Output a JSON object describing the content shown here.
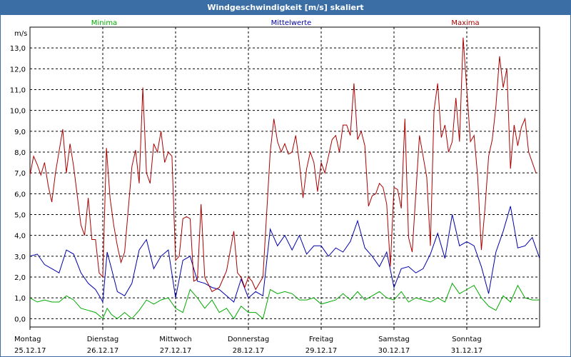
{
  "window": {
    "title": "Windgeschwindigkeit [m/s] skaliert"
  },
  "colors": {
    "titlebar": "#3a6ea5",
    "minima": "#00aa00",
    "mittel": "#0000aa",
    "maxima": "#aa0000",
    "grid": "#000000"
  },
  "chart_data": {
    "type": "line",
    "title": "Windgeschwindigkeit [m/s] skaliert",
    "ylabel": "m/s",
    "xlabel": "",
    "ylim": [
      -0.4,
      14.0
    ],
    "yticks": [
      "0,0",
      "1,0",
      "2,0",
      "3,0",
      "4,0",
      "5,0",
      "6,0",
      "7,0",
      "8,0",
      "9,0",
      "10,0",
      "11,0",
      "12,0",
      "13,0"
    ],
    "ytick_values": [
      0,
      1,
      2,
      3,
      4,
      5,
      6,
      7,
      8,
      9,
      10,
      11,
      12,
      13
    ],
    "xlim": [
      0,
      7
    ],
    "day_labels": [
      {
        "day": "Montag",
        "date": "25.12.17"
      },
      {
        "day": "Dienstag",
        "date": "26.12.17"
      },
      {
        "day": "Mittwoch",
        "date": "27.12.17"
      },
      {
        "day": "Donnerstag",
        "date": "28.12.17"
      },
      {
        "day": "Freitag",
        "date": "29.12.17"
      },
      {
        "day": "Samstag",
        "date": "30.12.17"
      },
      {
        "day": "Sonntag",
        "date": "31.12.17"
      }
    ],
    "grid": true,
    "legend_position": "top",
    "series": [
      {
        "name": "Minima",
        "color": "#00aa00",
        "points": [
          [
            0,
            1.0
          ],
          [
            0.1,
            0.8
          ],
          [
            0.2,
            0.9
          ],
          [
            0.3,
            0.8
          ],
          [
            0.4,
            0.8
          ],
          [
            0.5,
            1.1
          ],
          [
            0.6,
            0.9
          ],
          [
            0.7,
            0.5
          ],
          [
            0.8,
            0.4
          ],
          [
            0.9,
            0.3
          ],
          [
            1.0,
            0.0
          ],
          [
            1.06,
            0.5
          ],
          [
            1.12,
            0.2
          ],
          [
            1.2,
            0.0
          ],
          [
            1.3,
            0.3
          ],
          [
            1.4,
            0.0
          ],
          [
            1.5,
            0.4
          ],
          [
            1.6,
            0.9
          ],
          [
            1.7,
            0.7
          ],
          [
            1.8,
            0.9
          ],
          [
            1.9,
            1.0
          ],
          [
            2.0,
            0.5
          ],
          [
            2.1,
            0.3
          ],
          [
            2.2,
            1.4
          ],
          [
            2.3,
            1.0
          ],
          [
            2.4,
            0.5
          ],
          [
            2.5,
            0.9
          ],
          [
            2.6,
            0.3
          ],
          [
            2.7,
            0.5
          ],
          [
            2.8,
            0.0
          ],
          [
            2.9,
            0.6
          ],
          [
            3.0,
            0.3
          ],
          [
            3.1,
            0.3
          ],
          [
            3.2,
            0.0
          ],
          [
            3.3,
            1.4
          ],
          [
            3.4,
            1.2
          ],
          [
            3.5,
            1.3
          ],
          [
            3.6,
            1.2
          ],
          [
            3.7,
            0.9
          ],
          [
            3.8,
            0.9
          ],
          [
            3.9,
            1.0
          ],
          [
            4.0,
            0.7
          ],
          [
            4.1,
            0.8
          ],
          [
            4.2,
            0.9
          ],
          [
            4.3,
            1.2
          ],
          [
            4.4,
            0.9
          ],
          [
            4.5,
            1.3
          ],
          [
            4.6,
            0.9
          ],
          [
            4.7,
            1.1
          ],
          [
            4.8,
            1.3
          ],
          [
            4.9,
            1.0
          ],
          [
            5.0,
            0.9
          ],
          [
            5.1,
            1.3
          ],
          [
            5.2,
            0.8
          ],
          [
            5.3,
            1.0
          ],
          [
            5.4,
            0.9
          ],
          [
            5.5,
            0.8
          ],
          [
            5.6,
            1.0
          ],
          [
            5.7,
            0.8
          ],
          [
            5.8,
            1.7
          ],
          [
            5.9,
            1.2
          ],
          [
            6.0,
            1.4
          ],
          [
            6.1,
            1.6
          ],
          [
            6.2,
            1.0
          ],
          [
            6.3,
            0.6
          ],
          [
            6.4,
            0.4
          ],
          [
            6.5,
            1.1
          ],
          [
            6.6,
            0.8
          ],
          [
            6.7,
            1.6
          ],
          [
            6.8,
            1.0
          ],
          [
            6.9,
            0.9
          ],
          [
            7.0,
            0.9
          ]
        ]
      },
      {
        "name": "Mittelwerte",
        "color": "#0000aa",
        "points": [
          [
            0,
            3.0
          ],
          [
            0.1,
            3.1
          ],
          [
            0.2,
            2.6
          ],
          [
            0.3,
            2.4
          ],
          [
            0.4,
            2.2
          ],
          [
            0.5,
            3.3
          ],
          [
            0.6,
            3.1
          ],
          [
            0.7,
            2.2
          ],
          [
            0.8,
            1.7
          ],
          [
            0.9,
            1.4
          ],
          [
            0.97,
            1.0
          ],
          [
            1.0,
            0.8
          ],
          [
            1.06,
            3.2
          ],
          [
            1.12,
            2.4
          ],
          [
            1.2,
            1.3
          ],
          [
            1.3,
            1.1
          ],
          [
            1.4,
            1.7
          ],
          [
            1.5,
            3.3
          ],
          [
            1.6,
            3.8
          ],
          [
            1.7,
            2.4
          ],
          [
            1.8,
            3.0
          ],
          [
            1.9,
            3.3
          ],
          [
            2.0,
            1.0
          ],
          [
            2.1,
            2.8
          ],
          [
            2.2,
            3.0
          ],
          [
            2.3,
            1.8
          ],
          [
            2.4,
            1.7
          ],
          [
            2.5,
            1.5
          ],
          [
            2.6,
            1.4
          ],
          [
            2.7,
            1.1
          ],
          [
            2.8,
            0.8
          ],
          [
            2.9,
            1.9
          ],
          [
            3.0,
            1.0
          ],
          [
            3.1,
            1.3
          ],
          [
            3.2,
            1.1
          ],
          [
            3.3,
            4.3
          ],
          [
            3.4,
            3.5
          ],
          [
            3.5,
            4.0
          ],
          [
            3.6,
            3.3
          ],
          [
            3.7,
            4.0
          ],
          [
            3.8,
            3.1
          ],
          [
            3.9,
            3.5
          ],
          [
            4.0,
            3.5
          ],
          [
            4.1,
            3.0
          ],
          [
            4.2,
            3.4
          ],
          [
            4.3,
            3.2
          ],
          [
            4.4,
            3.7
          ],
          [
            4.5,
            4.7
          ],
          [
            4.6,
            3.4
          ],
          [
            4.7,
            3.0
          ],
          [
            4.8,
            2.5
          ],
          [
            4.9,
            3.2
          ],
          [
            5.0,
            1.5
          ],
          [
            5.1,
            2.4
          ],
          [
            5.2,
            2.5
          ],
          [
            5.3,
            2.2
          ],
          [
            5.4,
            2.4
          ],
          [
            5.5,
            3.1
          ],
          [
            5.6,
            4.1
          ],
          [
            5.7,
            2.9
          ],
          [
            5.8,
            5.0
          ],
          [
            5.9,
            3.5
          ],
          [
            6.0,
            3.7
          ],
          [
            6.1,
            3.5
          ],
          [
            6.2,
            2.5
          ],
          [
            6.3,
            1.2
          ],
          [
            6.4,
            3.2
          ],
          [
            6.5,
            4.2
          ],
          [
            6.6,
            5.4
          ],
          [
            6.7,
            3.4
          ],
          [
            6.8,
            3.5
          ],
          [
            6.9,
            3.9
          ],
          [
            7.0,
            2.9
          ]
        ]
      },
      {
        "name": "Maxima",
        "color": "#aa0000",
        "points": [
          [
            0,
            6.9
          ],
          [
            0.05,
            7.8
          ],
          [
            0.1,
            7.4
          ],
          [
            0.15,
            6.9
          ],
          [
            0.2,
            7.5
          ],
          [
            0.25,
            6.4
          ],
          [
            0.3,
            5.6
          ],
          [
            0.35,
            7.0
          ],
          [
            0.45,
            9.1
          ],
          [
            0.5,
            7.0
          ],
          [
            0.55,
            8.4
          ],
          [
            0.6,
            7.3
          ],
          [
            0.7,
            4.5
          ],
          [
            0.75,
            4.0
          ],
          [
            0.8,
            5.8
          ],
          [
            0.85,
            3.8
          ],
          [
            0.9,
            3.8
          ],
          [
            0.95,
            2.2
          ],
          [
            1.0,
            2.0
          ],
          [
            1.05,
            8.2
          ],
          [
            1.1,
            5.8
          ],
          [
            1.15,
            4.5
          ],
          [
            1.2,
            3.5
          ],
          [
            1.25,
            2.7
          ],
          [
            1.3,
            3.2
          ],
          [
            1.4,
            7.3
          ],
          [
            1.45,
            8.1
          ],
          [
            1.5,
            6.5
          ],
          [
            1.55,
            11.1
          ],
          [
            1.6,
            7.0
          ],
          [
            1.65,
            6.5
          ],
          [
            1.7,
            8.4
          ],
          [
            1.75,
            8.0
          ],
          [
            1.8,
            9.0
          ],
          [
            1.85,
            7.5
          ],
          [
            1.9,
            8.0
          ],
          [
            1.95,
            7.8
          ],
          [
            2.0,
            2.8
          ],
          [
            2.05,
            3.0
          ],
          [
            2.1,
            4.8
          ],
          [
            2.15,
            4.9
          ],
          [
            2.2,
            4.8
          ],
          [
            2.25,
            1.8
          ],
          [
            2.3,
            1.9
          ],
          [
            2.35,
            5.5
          ],
          [
            2.4,
            2.0
          ],
          [
            2.5,
            1.3
          ],
          [
            2.6,
            1.5
          ],
          [
            2.7,
            2.3
          ],
          [
            2.8,
            4.2
          ],
          [
            2.85,
            2.2
          ],
          [
            2.9,
            2.0
          ],
          [
            2.95,
            1.5
          ],
          [
            3.0,
            2.0
          ],
          [
            3.05,
            1.8
          ],
          [
            3.1,
            1.4
          ],
          [
            3.2,
            2.0
          ],
          [
            3.3,
            8.0
          ],
          [
            3.35,
            9.6
          ],
          [
            3.4,
            8.5
          ],
          [
            3.45,
            8.0
          ],
          [
            3.5,
            8.4
          ],
          [
            3.55,
            7.9
          ],
          [
            3.6,
            8.0
          ],
          [
            3.65,
            8.8
          ],
          [
            3.7,
            7.5
          ],
          [
            3.75,
            5.8
          ],
          [
            3.8,
            7.2
          ],
          [
            3.85,
            8.0
          ],
          [
            3.9,
            7.5
          ],
          [
            3.95,
            6.1
          ],
          [
            4.0,
            7.5
          ],
          [
            4.05,
            7.0
          ],
          [
            4.1,
            7.8
          ],
          [
            4.15,
            8.6
          ],
          [
            4.2,
            8.8
          ],
          [
            4.25,
            8.0
          ],
          [
            4.3,
            9.3
          ],
          [
            4.35,
            9.3
          ],
          [
            4.4,
            8.8
          ],
          [
            4.45,
            11.3
          ],
          [
            4.5,
            8.6
          ],
          [
            4.55,
            9.0
          ],
          [
            4.6,
            8.3
          ],
          [
            4.65,
            5.4
          ],
          [
            4.7,
            5.9
          ],
          [
            4.75,
            6.0
          ],
          [
            4.8,
            6.5
          ],
          [
            4.85,
            6.3
          ],
          [
            4.9,
            5.5
          ],
          [
            4.95,
            2.5
          ],
          [
            5.0,
            6.3
          ],
          [
            5.05,
            6.2
          ],
          [
            5.1,
            5.3
          ],
          [
            5.15,
            9.6
          ],
          [
            5.2,
            3.9
          ],
          [
            5.25,
            3.2
          ],
          [
            5.3,
            6.0
          ],
          [
            5.35,
            8.8
          ],
          [
            5.4,
            7.8
          ],
          [
            5.45,
            6.8
          ],
          [
            5.5,
            3.5
          ],
          [
            5.55,
            10.0
          ],
          [
            5.6,
            11.3
          ],
          [
            5.65,
            8.7
          ],
          [
            5.7,
            9.3
          ],
          [
            5.75,
            8.0
          ],
          [
            5.8,
            8.5
          ],
          [
            5.85,
            10.6
          ],
          [
            5.9,
            8.5
          ],
          [
            5.95,
            13.5
          ],
          [
            6.0,
            11.0
          ],
          [
            6.05,
            8.5
          ],
          [
            6.1,
            8.8
          ],
          [
            6.15,
            6.8
          ],
          [
            6.2,
            3.3
          ],
          [
            6.25,
            5.3
          ],
          [
            6.3,
            7.8
          ],
          [
            6.35,
            8.6
          ],
          [
            6.4,
            10.2
          ],
          [
            6.45,
            12.6
          ],
          [
            6.5,
            11.1
          ],
          [
            6.55,
            12.0
          ],
          [
            6.6,
            7.2
          ],
          [
            6.65,
            9.3
          ],
          [
            6.7,
            8.3
          ],
          [
            6.75,
            9.2
          ],
          [
            6.8,
            9.6
          ],
          [
            6.85,
            8.0
          ],
          [
            6.95,
            7.0
          ]
        ]
      }
    ]
  }
}
